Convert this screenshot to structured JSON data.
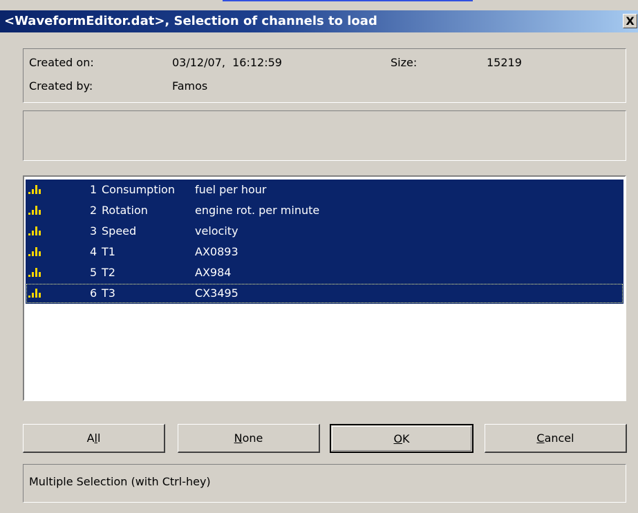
{
  "window": {
    "title": "<WaveformEditor.dat>, Selection of channels to load",
    "close_label": "X"
  },
  "info": {
    "created_on_label": "Created on:",
    "created_on_value": "03/12/07,  16:12:59",
    "size_label": "Size:",
    "size_value": "15219",
    "created_by_label": "Created by:",
    "created_by_value": "Famos"
  },
  "channels": [
    {
      "num": "1",
      "name": "Consumption",
      "desc": "fuel per hour"
    },
    {
      "num": "2",
      "name": "Rotation",
      "desc": "engine rot. per minute"
    },
    {
      "num": "3",
      "name": "Speed",
      "desc": "velocity"
    },
    {
      "num": "4",
      "name": "T1",
      "desc": "AX0893"
    },
    {
      "num": "5",
      "name": "T2",
      "desc": "AX984"
    },
    {
      "num": "6",
      "name": "T3",
      "desc": "CX3495"
    }
  ],
  "buttons": {
    "all_pre": "A",
    "all_ul": "l",
    "all_post": "l",
    "none_pre": "",
    "none_ul": "N",
    "none_post": "one",
    "ok_pre": "",
    "ok_ul": "O",
    "ok_post": "K",
    "cancel_pre": "",
    "cancel_ul": "C",
    "cancel_post": "ancel"
  },
  "status": {
    "text": "Multiple Selection (with Ctrl-hey)"
  },
  "colors": {
    "selection": "#0a246a",
    "face": "#d4d0c8",
    "title_start": "#0a246a",
    "title_end": "#a6caf0"
  },
  "icons": {
    "channel": "signal-bars-icon",
    "close": "close-icon"
  }
}
